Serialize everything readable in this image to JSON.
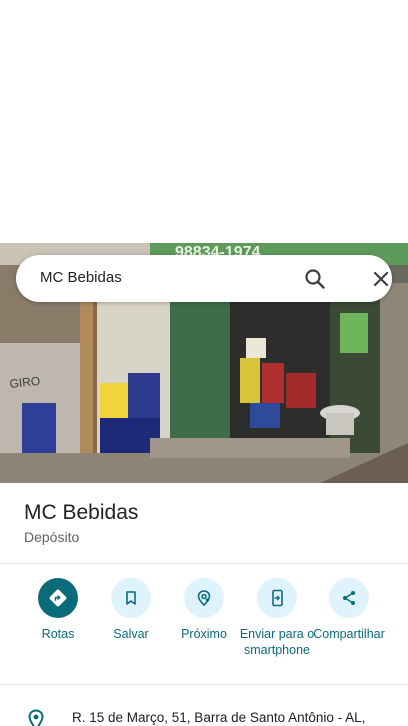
{
  "search": {
    "query": "MC Bebidas"
  },
  "place": {
    "name": "MC Bebidas",
    "category": "Depósito"
  },
  "photo": {
    "sign_text": "98834-1974"
  },
  "actions": [
    {
      "label": "Rotas",
      "icon": "directions-icon"
    },
    {
      "label": "Salvar",
      "icon": "bookmark-icon"
    },
    {
      "label": "Próximo",
      "icon": "nearby-icon"
    },
    {
      "label": "Enviar para o smartphone",
      "icon": "send-to-phone-icon"
    },
    {
      "label": "Compartilhar",
      "icon": "share-icon"
    }
  ],
  "address": {
    "text": "R. 15 de Março, 51, Barra de Santo Antônio - AL,"
  },
  "colors": {
    "accent": "#0b6b7a",
    "action_circle": "#dff3fc"
  }
}
